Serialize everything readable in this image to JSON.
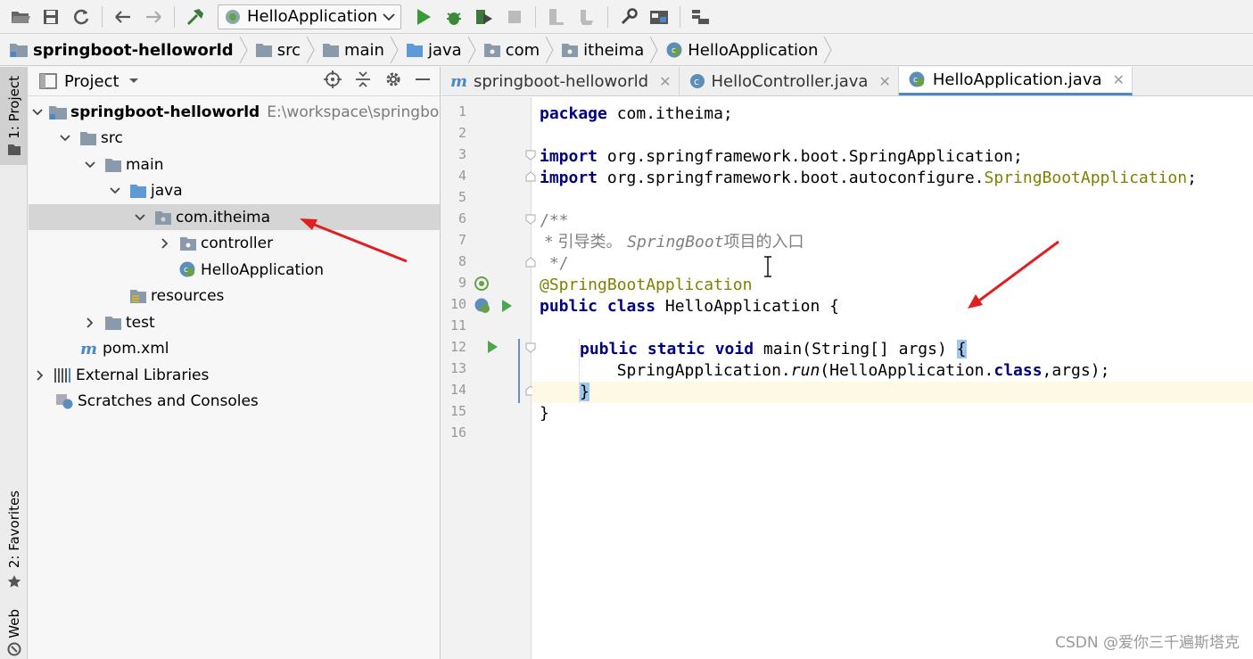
{
  "toolbar": {
    "run_config": "HelloApplication",
    "buttons": [
      "open-icon",
      "save-icon",
      "sync-icon",
      "back-icon",
      "forward-icon",
      "build-icon",
      "run-icon",
      "debug-icon",
      "coverage-icon",
      "stop-icon",
      "project-structure-icon",
      "sdk-icon",
      "settings-icon",
      "layout-icon",
      "vcs-icon"
    ]
  },
  "breadcrumb": {
    "items": [
      {
        "label": "springboot-helloworld",
        "bold": true
      },
      {
        "label": "src"
      },
      {
        "label": "main"
      },
      {
        "label": "java"
      },
      {
        "label": "com"
      },
      {
        "label": "itheima"
      },
      {
        "label": "HelloApplication"
      }
    ]
  },
  "left_strip": {
    "project_tab": "1: Project",
    "favorites_tab": "2: Favorites",
    "web_tab": "Web"
  },
  "project_panel": {
    "title": "Project",
    "tree": [
      {
        "label": "springboot-helloworld",
        "path": "E:\\workspace\\springboo",
        "bold": true
      },
      {
        "label": "src"
      },
      {
        "label": "main"
      },
      {
        "label": "java"
      },
      {
        "label": "com.itheima",
        "selected": true
      },
      {
        "label": "controller"
      },
      {
        "label": "HelloApplication"
      },
      {
        "label": "resources"
      },
      {
        "label": "test"
      },
      {
        "label": "pom.xml"
      },
      {
        "label": "External Libraries"
      },
      {
        "label": "Scratches and Consoles"
      }
    ]
  },
  "editor": {
    "tabs": [
      {
        "label": "springboot-helloworld",
        "active": false
      },
      {
        "label": "HelloController.java",
        "active": false
      },
      {
        "label": "HelloApplication.java",
        "active": true
      }
    ],
    "line_numbers": [
      "1",
      "2",
      "3",
      "4",
      "5",
      "6",
      "7",
      "8",
      "9",
      "10",
      "11",
      "12",
      "13",
      "14",
      "15",
      "16"
    ],
    "code": {
      "l1_kw": "package",
      "l1_rest": " com.itheima;",
      "l3_kw": "import",
      "l3_rest": " org.springframework.boot.SpringApplication;",
      "l4_kw": "import",
      "l4_rest": " org.springframework.boot.autoconfigure.",
      "l4_ann": "SpringBootApplication",
      "l4_end": ";",
      "l6": "/**",
      "l7_a": " * 引导类。 ",
      "l7_b": "SpringBoot",
      "l7_c": "项目的入口",
      "l8": " */",
      "l9": "@SpringBootApplication",
      "l10_kw": "public class",
      "l10_rest": " HelloApplication {",
      "l12_kw": "public static void",
      "l12_rest": " main(String[] args) ",
      "l12_brace": "{",
      "l13_a": "        SpringApplication.",
      "l13_b": "run",
      "l13_c": "(HelloApplication.",
      "l13_kw": "class",
      "l13_d": ",args);",
      "l14_brace": "}",
      "l15": "}"
    }
  },
  "watermark": "CSDN @爱你三千遍斯塔克",
  "colors": {
    "keyword": "#000080",
    "annotation": "#808000",
    "comment": "#808080",
    "arrow": "#e02020",
    "folder": "#8b9aab",
    "source_folder": "#5d9ad6",
    "run_green": "#3a9a3a"
  }
}
